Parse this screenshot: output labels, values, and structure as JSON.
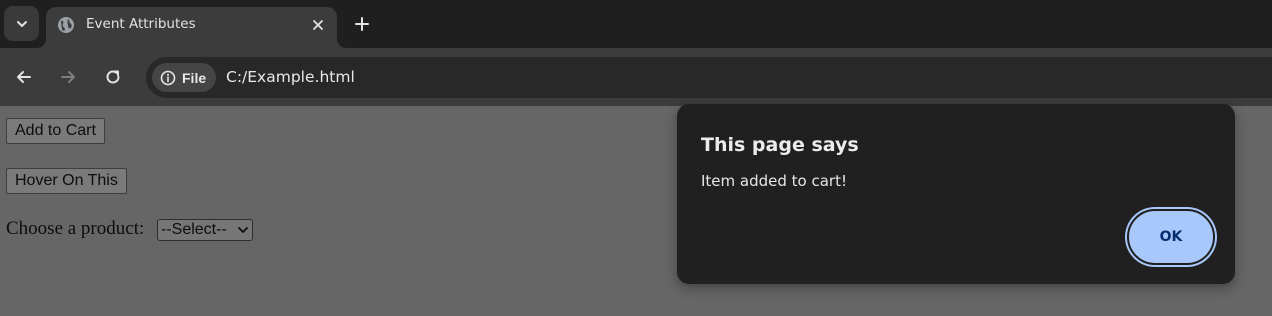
{
  "browser": {
    "tab": {
      "title": "Event Attributes"
    },
    "address_bar": {
      "chip_label": "File",
      "url": "C:/Example.html"
    },
    "icons": {
      "tab_search": "chevron-down-icon",
      "favicon": "globe-icon",
      "close": "close-icon",
      "new_tab": "plus-icon",
      "back": "arrow-left-icon",
      "forward": "arrow-right-icon",
      "reload": "reload-icon",
      "site_info": "info-icon"
    }
  },
  "page": {
    "add_to_cart_label": "Add to Cart",
    "hover_label": "Hover On This",
    "choose_label": "Choose a product:",
    "select": {
      "selected": "--Select--"
    }
  },
  "dialog": {
    "title": "This page says",
    "message": "Item added to cart!",
    "ok_label": "OK"
  },
  "colors": {
    "page_background": "#666666",
    "chrome_dark": "#1f1f1f",
    "toolbar": "#3c3c3c",
    "dialog_bg": "#202020",
    "ok_button": "#a8c7fa",
    "ok_text": "#062e6f"
  }
}
